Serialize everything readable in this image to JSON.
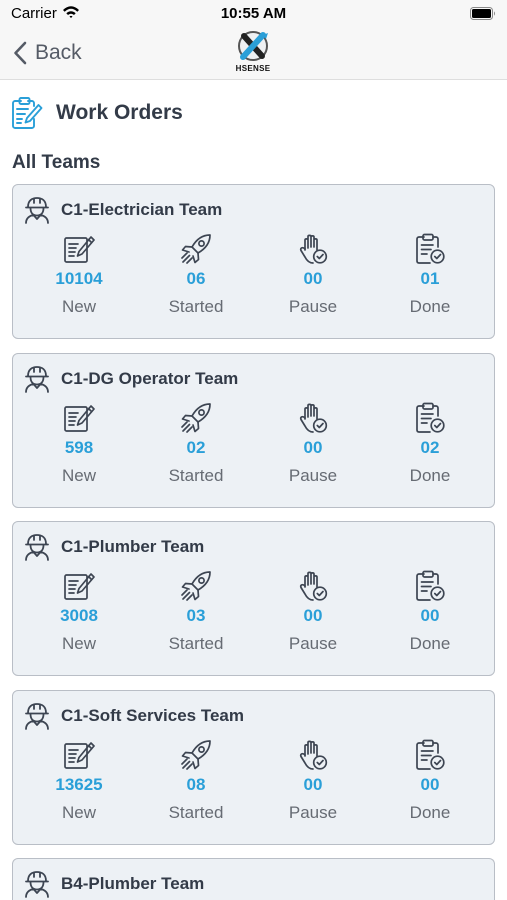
{
  "status_bar": {
    "carrier": "Carrier",
    "time": "10:55 AM"
  },
  "nav": {
    "back_label": "Back",
    "logo_text": "HSENSE"
  },
  "page": {
    "title": "Work Orders",
    "section": "All Teams"
  },
  "stat_labels": [
    "New",
    "Started",
    "Pause",
    "Done"
  ],
  "teams": [
    {
      "name": "C1-Electrician Team",
      "new": "10104",
      "started": "06",
      "pause": "00",
      "done": "01"
    },
    {
      "name": "C1-DG Operator Team",
      "new": "598",
      "started": "02",
      "pause": "00",
      "done": "02"
    },
    {
      "name": "C1-Plumber Team",
      "new": "3008",
      "started": "03",
      "pause": "00",
      "done": "00"
    },
    {
      "name": "C1-Soft Services Team",
      "new": "13625",
      "started": "08",
      "pause": "00",
      "done": "00"
    },
    {
      "name": "B4-Plumber Team"
    }
  ],
  "colors": {
    "accent": "#2a9fd8",
    "card_bg": "#edf1f5",
    "card_border": "#b9bec6",
    "title": "#333b48"
  },
  "icons": {
    "header": "workorder-clipboard-icon",
    "team": "worker-helmet-icon",
    "new": "document-edit-icon",
    "started": "rocket-icon",
    "pause": "hand-stop-icon",
    "done": "clipboard-check-icon"
  }
}
